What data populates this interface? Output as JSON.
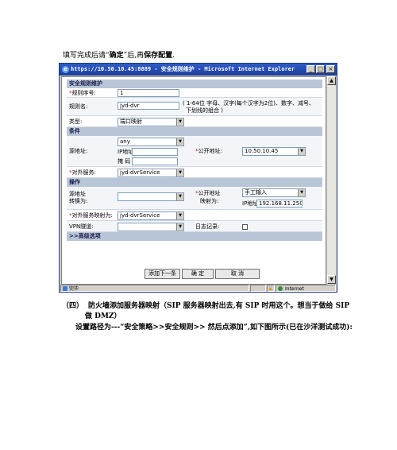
{
  "doc": {
    "intro_pre": "填写完成后请“",
    "intro_b1": "确定",
    "intro_mid": "”后,再",
    "intro_b2": "保存配置",
    "intro_end": ".",
    "section_num": "（四）",
    "section_text": "防火墙添加服务器映射（SIP 服务器映射出去,有 SIP 时用这个。想当于做给 SIP",
    "section_text2": "做 DMZ）",
    "path_text": "设置路径为---“安全策略>>安全规则>>  然后点添加”,如下图所示(已在沙洋测试成功):"
  },
  "window": {
    "title": "https://10.50.10.45:8889 - 安全规则维护 - Microsoft Internet Explorer",
    "btn_min": "_",
    "btn_max": "□",
    "btn_close": "×",
    "scroll_up": "▲",
    "scroll_down": "▼"
  },
  "form": {
    "title": "安全规则维护",
    "req_mark": "*",
    "rule_no_label": "规则序号:",
    "rule_no_value": "1",
    "rule_name_label": "规则名:",
    "rule_name_value": "jyd-dvr",
    "rule_name_hint1": "( 1-64位 字母、汉字(每个汉字为2位)、数字、减号、",
    "rule_name_hint2": "下划线的组合 )",
    "type_label": "类型:",
    "type_value": "端口映射",
    "cond_header": "条件",
    "src_label": "源地址:",
    "src_value": "any",
    "ip_label": "IP地址",
    "mask_label": "掩 码",
    "public_label": "公开地址:",
    "public_value": "10.50.10.45",
    "ext_service_label": "对外服务:",
    "ext_service_value": "jyd-dvrService",
    "op_header": "操作",
    "src_trans_label1": "源地址",
    "src_trans_label2": "转换为:",
    "public_map_label1": "公开地址",
    "public_map_label2": "映射为:",
    "manual_value": "手工输入",
    "map_ip_label": "IP地址",
    "map_ip_value": "192.168.11.250",
    "ext_map_label": "对外服务映射为:",
    "ext_map_value": "jyd-dvrService",
    "vpn_label": "VPN隧道:",
    "log_label": "日志记录:",
    "adv_header": ">>高级选项",
    "btn_add_next": "添加下一条",
    "btn_ok": "确 定",
    "btn_cancel": "取 消"
  },
  "status": {
    "done": "完毕",
    "zone": "Internet",
    "lock": "🔒"
  }
}
